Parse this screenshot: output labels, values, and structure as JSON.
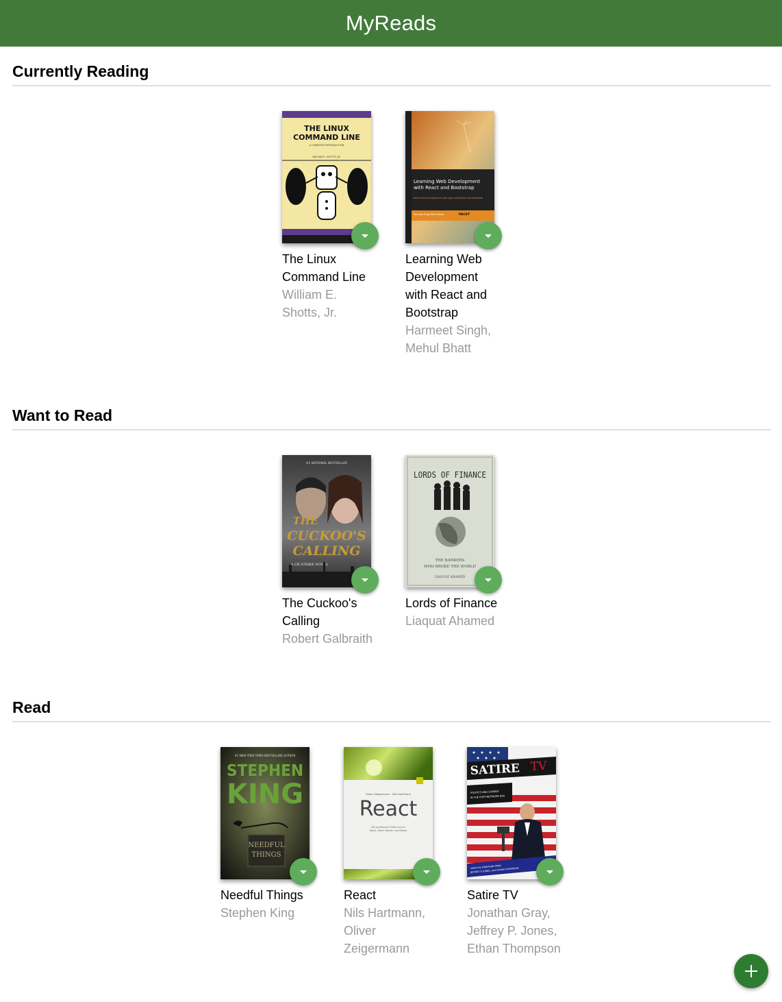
{
  "app": {
    "title": "MyReads"
  },
  "colors": {
    "header": "#427a3b",
    "changer": "#60ac5d",
    "add": "#2e7c31",
    "author": "#999999"
  },
  "shelves": [
    {
      "title": "Currently Reading",
      "books": [
        {
          "title": "The Linux Command Line",
          "authors": "William E. Shotts, Jr.",
          "cover": {
            "lines": [
              "THE LINUX",
              "COMMAND LINE"
            ],
            "kicker": "A COMPLETE INTRODUCTION",
            "author": "WILLIAM E. SHOTTS, JR."
          }
        },
        {
          "title": "Learning Web Development with React and Bootstrap",
          "authors": "Harmeet Singh, Mehul Bhatt",
          "cover": {
            "lines": [
              "Learning Web Development",
              "with React and Bootstrap"
            ],
            "sub": "Build real-time responsive web apps using React and Bootstrap",
            "author": "Harmeet Singh Mehul Bhatt",
            "publisher": "PACKT"
          }
        }
      ]
    },
    {
      "title": "Want to Read",
      "books": [
        {
          "title": "The Cuckoo's Calling",
          "authors": "Robert Galbraith",
          "cover": {
            "top": "#1 NATIONAL BESTSELLER",
            "lines": [
              "THE",
              "CUCKOO'S",
              "CALLING"
            ],
            "sub": "A CB STRIKE NOVEL"
          }
        },
        {
          "title": "Lords of Finance",
          "authors": "Liaquat Ahamed",
          "cover": {
            "lines": [
              "LORDS OF FINANCE"
            ],
            "sub": [
              "THE BANKERS",
              "WHO BROKE THE WORLD"
            ],
            "author": "LIAQUAT AHAMED"
          }
        }
      ]
    },
    {
      "title": "Read",
      "books": [
        {
          "title": "Needful Things",
          "authors": "Stephen King",
          "cover": {
            "top": "#1 NEW YORK TIMES BESTSELLING AUTHOR",
            "lines": [
              "STEPHEN",
              "KING"
            ],
            "sign": [
              "NEEDFUL",
              "THINGS"
            ]
          }
        },
        {
          "title": "React",
          "authors": "Nils Hartmann, Oliver Zeigermann",
          "cover": {
            "authors": "Oliver Zeigermann · Nils Hartmann",
            "lines": [
              "React"
            ],
            "sub": [
              "Die praktische Einführung in",
              "React, React Router und Redux"
            ]
          }
        },
        {
          "title": "Satire TV",
          "authors": "Jonathan Gray, Jeffrey P. Jones, Ethan Thompson",
          "cover": {
            "lines": [
              "SATIRE",
              "TV"
            ],
            "sub": [
              "POLITICS AND COMEDY",
              "IN THE POST-NETWORK ERA"
            ],
            "editors": [
              "edited by JONATHAN GRAY,",
              "JEFFREY P. JONES, and ETHAN THOMPSON"
            ]
          }
        }
      ]
    }
  ]
}
